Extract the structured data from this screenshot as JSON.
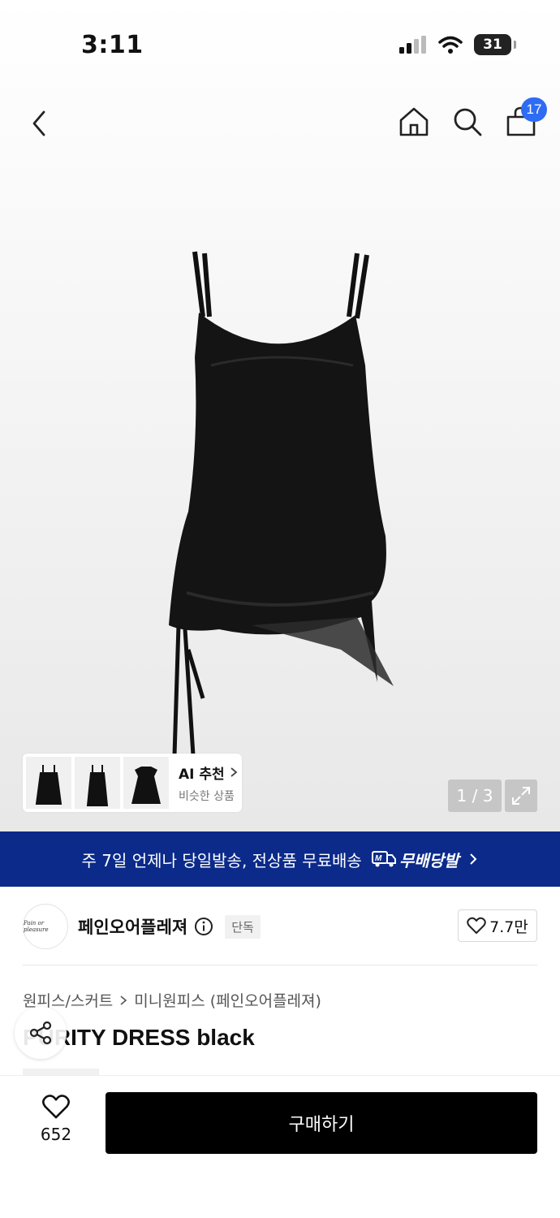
{
  "status_bar": {
    "time": "3:11",
    "battery": "31"
  },
  "nav": {
    "cart_count": "17"
  },
  "hero": {
    "ai_card": {
      "title": "AI 추천",
      "subtitle": "비슷한 상품"
    },
    "pager": "1 / 3"
  },
  "banner": {
    "text": "주 7일 언제나 당일발송, 전상품 무료배송",
    "logo_text": "무배당발"
  },
  "brand": {
    "logo_text": "Pain or pleasure",
    "name": "페인오어플레져",
    "tag": "단독",
    "likes": "7.7만"
  },
  "breadcrumb": {
    "category": "원피스/스커트",
    "subcategory": "미니원피스 (페인오어플레져)"
  },
  "product": {
    "title": "PURITY DRESS black"
  },
  "bottom": {
    "wish_count": "652",
    "buy_label": "구매하기"
  },
  "colors": {
    "accent_blue": "#2f6cf4",
    "banner_navy": "#0b2a8a",
    "buy_black": "#000000"
  }
}
